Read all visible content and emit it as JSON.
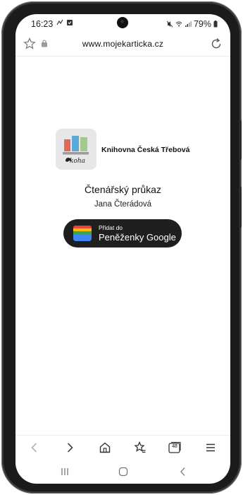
{
  "status_bar": {
    "time": "16:23",
    "battery": "79%",
    "icons_left": [
      "missed-call-icon",
      "checkbox-notification-icon"
    ],
    "icons_right": [
      "mute-icon",
      "wifi-icon",
      "signal-icon",
      "battery-icon"
    ]
  },
  "browser": {
    "url": "www.mojekarticka.cz"
  },
  "library": {
    "name": "Knihovna Česká Třebová",
    "logo_text": "koha"
  },
  "card": {
    "title": "Čtenářský průkaz",
    "holder": "Jana Čterádová"
  },
  "wallet_button": {
    "line1": "Přidat do",
    "line2": "Peněženky Google"
  },
  "toolbar": {
    "tabs_count": "48",
    "items": [
      "back-icon",
      "forward-icon",
      "home-icon",
      "bookmarks-icon",
      "tabs-icon",
      "menu-icon"
    ]
  },
  "colors": {
    "button_bg": "#1f1f1f",
    "logo_bar_red": "#e0695a",
    "logo_bar_blue": "#5aa9d6",
    "logo_bar_green": "#a5c98a"
  }
}
